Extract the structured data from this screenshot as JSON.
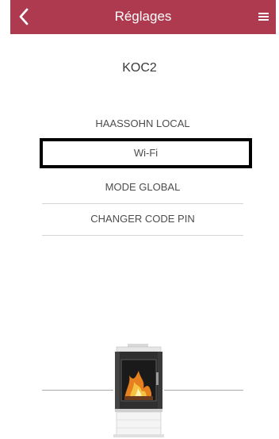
{
  "header": {
    "title": "Réglages",
    "back_icon": "chevron-left-icon",
    "menu_icon": "hamburger-menu-icon",
    "background_color": "#ad3a4e"
  },
  "device": {
    "name": "KOC2"
  },
  "menu": {
    "items": [
      {
        "label": "HAASSOHN LOCAL"
      },
      {
        "label": "Wi-Fi",
        "selected": true
      },
      {
        "label": "MODE GLOBAL"
      },
      {
        "label": "CHANGER CODE PIN"
      }
    ]
  },
  "illustration": {
    "icon": "stove-icon"
  }
}
